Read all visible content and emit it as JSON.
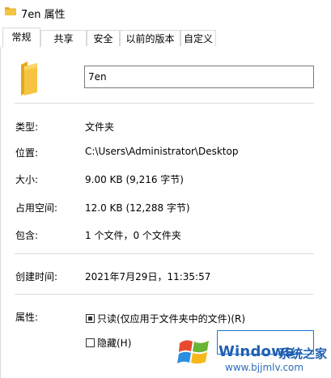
{
  "window": {
    "title": "7en 属性"
  },
  "tabs": [
    {
      "label": "常规",
      "active": true
    },
    {
      "label": "共享",
      "active": false
    },
    {
      "label": "安全",
      "active": false
    },
    {
      "label": "以前的版本",
      "active": false
    },
    {
      "label": "自定义",
      "active": false
    }
  ],
  "general": {
    "folder_icon": "folder-icon",
    "name_value": "7en",
    "type_label": "类型:",
    "type_value": "文件夹",
    "location_label": "位置:",
    "location_value": "C:\\Users\\Administrator\\Desktop",
    "size_label": "大小:",
    "size_value": "9.00 KB (9,216 字节)",
    "size_on_disk_label": "占用空间:",
    "size_on_disk_value": "12.0 KB (12,288 字节)",
    "contains_label": "包含:",
    "contains_value": "1 个文件，0 个文件夹",
    "created_label": "创建时间:",
    "created_value": "2021年7月29日，11:35:57",
    "attributes_label": "属性:",
    "readonly_label": "只读(仅应用于文件夹中的文件)(R)",
    "readonly_checked": true,
    "hidden_label": "隐藏(H)",
    "hidden_checked": false
  },
  "colors": {
    "folder_yellow": "#f5c542",
    "folder_shade": "#e3a81c",
    "accent_blue": "#1a73d8",
    "watermark_blue": "#1f5fb0"
  },
  "watermark": {
    "brand": "Windows",
    "cn_text": "系统之家",
    "url": "www.bjjmlv.com"
  }
}
